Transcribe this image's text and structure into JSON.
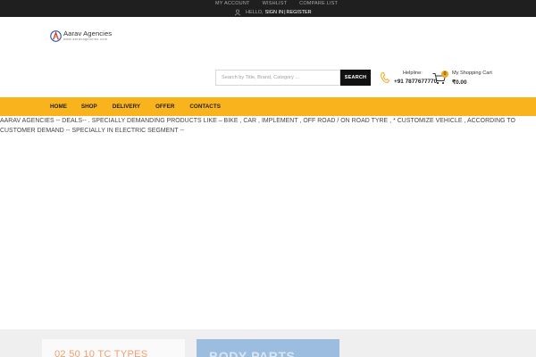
{
  "topbar": {
    "links": [
      "MY ACCOUNT",
      "WISHLIST",
      "COMPARE LIST"
    ],
    "hello": "HELLO,",
    "sign_in": "SIGN IN",
    "separator": "|",
    "register": "REGISTER"
  },
  "logo": {
    "title": "Aarav Agencies",
    "subtitle": "www.aaravagencies.com"
  },
  "search": {
    "placeholder": "Search by Title, Brand, Category ...",
    "button_label": "SEARCH"
  },
  "helpline": {
    "label": "Helpline:",
    "number": "+91 7877677770"
  },
  "cart": {
    "count": "0",
    "label": "My Shopping Cart",
    "total": "₹0.00"
  },
  "nav": {
    "items": [
      "HOME",
      "SHOP",
      "DELIVERY",
      "OFFER",
      "CONTACTS"
    ]
  },
  "notice": {
    "text": "AARAV AGENCIES -- DEALS-- . SPECIALLY DEMANDING PRODUCTS LIKE – BIKE , CAR , IMPLEMENT , OFF ROAD / ON ROAD TYRE , * CUSTOMIZE VEHICLE , ACCORDING TO CUSTOMER DEMAND -- SPECIALLY IN ELECTRIC SEGMENT --"
  },
  "promo": {
    "left_text": "02 50 10 TC TYPES",
    "right_text": "BODY PARTS"
  },
  "colors": {
    "accent": "#f9b31c",
    "topbar": "#1f1f1f",
    "search_button": "#111111"
  }
}
